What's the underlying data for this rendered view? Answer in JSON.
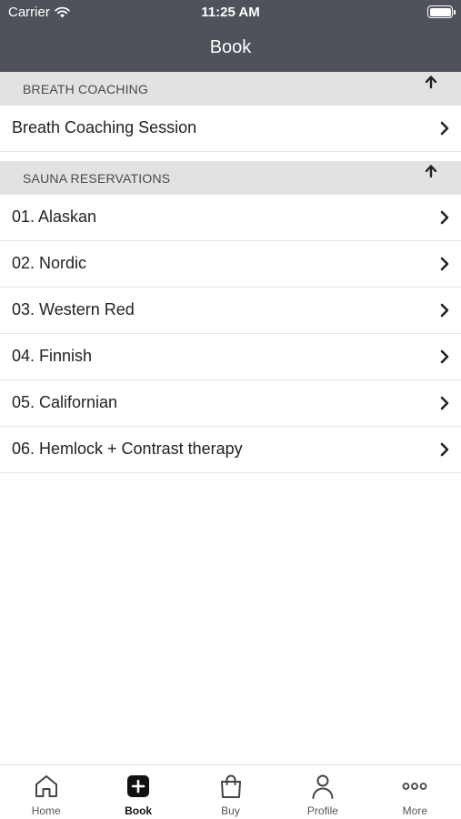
{
  "status_bar": {
    "carrier": "Carrier",
    "time": "11:25 AM"
  },
  "nav": {
    "title": "Book"
  },
  "sections": [
    {
      "title": "BREATH COACHING",
      "items": [
        "Breath Coaching Session"
      ]
    },
    {
      "title": "SAUNA RESERVATIONS",
      "items": [
        "01. Alaskan",
        "02. Nordic",
        "03. Western Red",
        "04. Finnish",
        "05. Californian",
        "06. Hemlock + Contrast therapy"
      ]
    }
  ],
  "tabs": [
    {
      "label": "Home",
      "icon": "home-icon",
      "active": false
    },
    {
      "label": "Book",
      "icon": "plus-square-icon",
      "active": true
    },
    {
      "label": "Buy",
      "icon": "shopping-bag-icon",
      "active": false
    },
    {
      "label": "Profile",
      "icon": "person-icon",
      "active": false
    },
    {
      "label": "More",
      "icon": "more-dots-icon",
      "active": false
    }
  ]
}
